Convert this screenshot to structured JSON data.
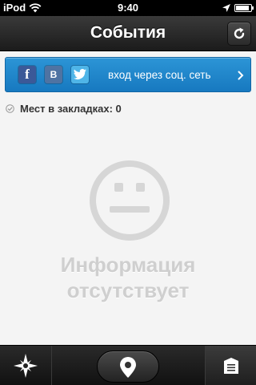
{
  "status_bar": {
    "carrier": "iPod",
    "time": "9:40",
    "icons": [
      "wifi-icon",
      "location-arrow-icon",
      "battery-icon"
    ]
  },
  "nav_bar": {
    "title": "События",
    "refresh_icon": "refresh-icon"
  },
  "social_banner": {
    "networks": [
      {
        "name": "facebook",
        "glyph": "f"
      },
      {
        "name": "vkontakte",
        "glyph": "B"
      },
      {
        "name": "twitter",
        "glyph": ""
      }
    ],
    "label": "вход через соц. сеть",
    "chevron_icon": "chevron-right-icon",
    "colors": {
      "background": "#1f86cb",
      "text": "#ffffff"
    }
  },
  "bookmarks": {
    "label": "Мест в закладках: 0",
    "icon": "check-circle-icon"
  },
  "empty_state": {
    "icon": "neutral-face-icon",
    "line1": "Информация",
    "line2": "отсутствует",
    "color": "#cfcfcf"
  },
  "tab_bar": {
    "tabs": [
      {
        "name": "discover",
        "icon": "compass-star-icon",
        "selected": false
      },
      {
        "name": "map",
        "icon": "map-pin-icon",
        "selected": false
      },
      {
        "name": "bookmarks",
        "icon": "list-document-icon",
        "selected": true
      }
    ]
  }
}
